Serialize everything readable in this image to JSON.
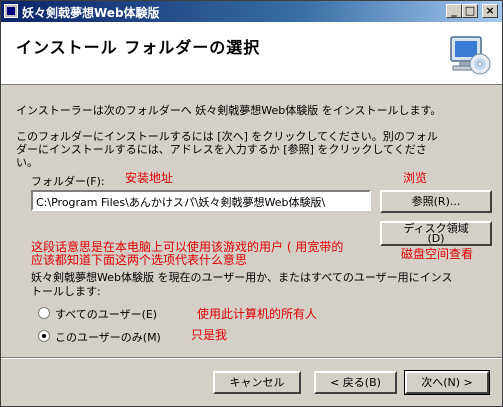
{
  "window": {
    "title": "妖々剣戟夢想Web体験版",
    "controls": {
      "minimize": "_",
      "maximize": "□",
      "close": "×"
    }
  },
  "banner": {
    "title": "インストール フォルダーの選択",
    "icon": "computer-cd-icon"
  },
  "intro": "インストーラーは次のフォルダーへ 妖々剣戟夢想Web体験版 をインストールします。",
  "instruction_line1": "このフォルダーにインストールするには [次へ] をクリックしてください。別のフォル",
  "instruction_line2": "ダーにインストールするには、アドレスを入力するか [参照] をクリックしてくださ",
  "instruction_line3": "い。",
  "folder": {
    "label": "フォルダー(F):",
    "value": "C:\\Program Files\\あんかけスパ\\妖々剣戟夢想Web体験版\\",
    "browse_label": "参照(R)...",
    "disk_cost_label_line1": "ディスク領域",
    "disk_cost_label_line2": "(D)"
  },
  "annotations": {
    "install_path": "安装地址",
    "browse": "浏览",
    "disk_space": "磁盘空间查看",
    "note_line1": "这段话意思是在本电脑上可以使用该游戏的用户 ( 用宽带的",
    "note_line2": "应该都知道下面这两个选项代表什么意思",
    "everyone": "使用此计算机的所有人",
    "just_me": "只是我"
  },
  "users": {
    "prompt_line1": "妖々剣戟夢想Web体験版 を現在のユーザー用か、またはすべてのユーザー用にインス",
    "prompt_line2": "トールします:",
    "everyone_label": "すべてのユーザー(E)",
    "just_me_label": "このユーザーのみ(M)",
    "selected": "just_me"
  },
  "footer": {
    "cancel_label": "キャンセル",
    "back_label": "< 戻る(B)",
    "next_label": "次へ(N) >"
  }
}
